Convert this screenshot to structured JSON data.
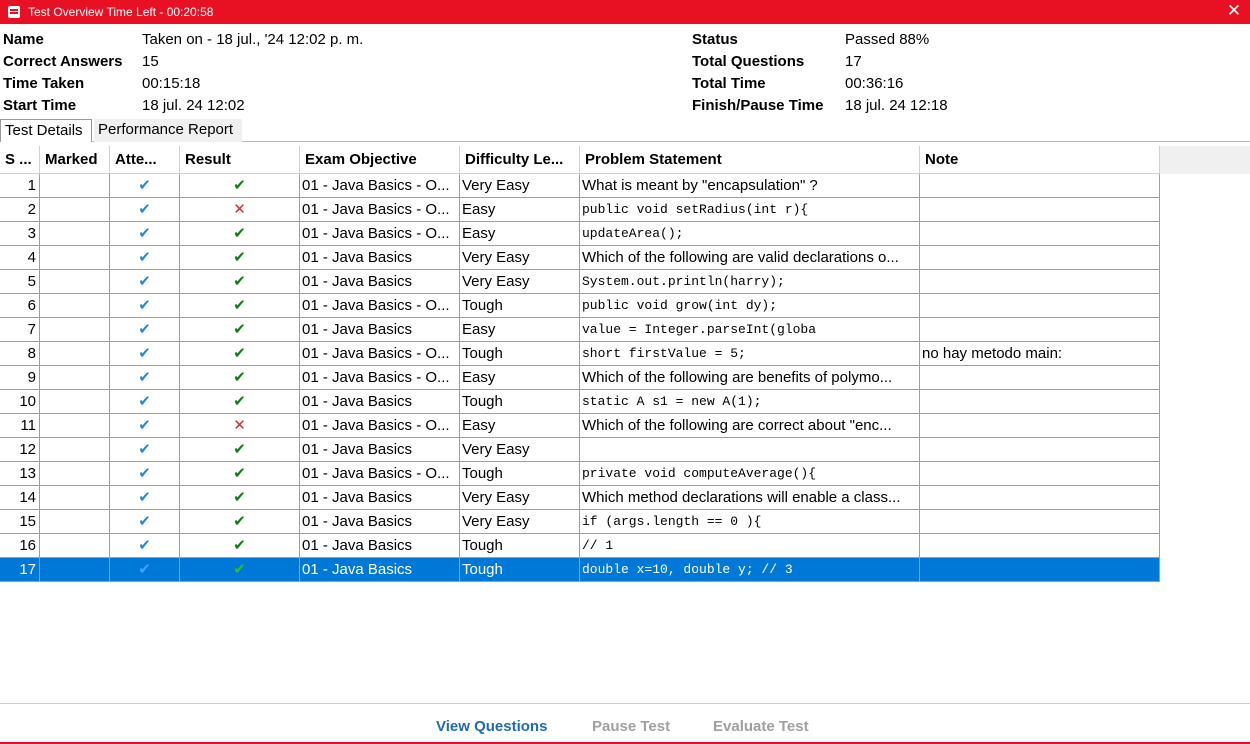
{
  "window": {
    "title": "Test Overview   Time Left - 00:20:58",
    "close_glyph": "✕"
  },
  "summary": {
    "left": [
      {
        "label": "Name",
        "value": "Taken on - 18 jul., '24 12:02 p. m."
      },
      {
        "label": "Correct Answers",
        "value": "15"
      },
      {
        "label": "Time Taken",
        "value": "00:15:18"
      },
      {
        "label": "Start Time",
        "value": "18 jul. 24 12:02"
      }
    ],
    "right": [
      {
        "label": "Status",
        "value": "Passed 88%"
      },
      {
        "label": "Total Questions",
        "value": "17"
      },
      {
        "label": "Total Time",
        "value": "00:36:16"
      },
      {
        "label": "Finish/Pause Time",
        "value": "18 jul. 24 12:18"
      }
    ]
  },
  "tabs": [
    {
      "label": "Test Details",
      "active": true
    },
    {
      "label": "Performance Report",
      "active": false
    }
  ],
  "table": {
    "columns": [
      "S ...",
      "Marked",
      "Atte...",
      "Result",
      "Exam Objective",
      "Difficulty Le...",
      "Problem Statement",
      "Note"
    ],
    "rows": [
      {
        "n": "1",
        "marked": "",
        "attempted": "✔",
        "result": "✔",
        "correct": true,
        "objective": "01 - Java Basics - O...",
        "difficulty": "Very Easy",
        "problem": "What is meant by \"encapsulation\" ?",
        "code": false,
        "note": ""
      },
      {
        "n": "2",
        "marked": "",
        "attempted": "✔",
        "result": "✕",
        "correct": false,
        "objective": "01 - Java Basics - O...",
        "difficulty": "Easy",
        "problem": "    public void setRadius(int r){",
        "code": true,
        "note": ""
      },
      {
        "n": "3",
        "marked": "",
        "attempted": "✔",
        "result": "✔",
        "correct": true,
        "objective": "01 - Java Basics - O...",
        "difficulty": "Easy",
        "problem": "      updateArea();",
        "code": true,
        "note": ""
      },
      {
        "n": "4",
        "marked": "",
        "attempted": "✔",
        "result": "✔",
        "correct": true,
        "objective": "01 - Java Basics",
        "difficulty": "Very Easy",
        "problem": "Which of the following are valid declarations o...",
        "code": false,
        "note": ""
      },
      {
        "n": "5",
        "marked": "",
        "attempted": "✔",
        "result": "✔",
        "correct": true,
        "objective": "01 - Java Basics",
        "difficulty": "Very Easy",
        "problem": "    System.out.println(harry);",
        "code": true,
        "note": ""
      },
      {
        "n": "6",
        "marked": "",
        "attempted": "✔",
        "result": "✔",
        "correct": true,
        "objective": "01 - Java Basics - O...",
        "difficulty": "Tough",
        "problem": "  public void grow(int dy);",
        "code": true,
        "note": ""
      },
      {
        "n": "7",
        "marked": "",
        "attempted": "✔",
        "result": "✔",
        "correct": true,
        "objective": "01 - Java Basics",
        "difficulty": "Easy",
        "problem": "        value = Integer.parseInt(globa",
        "code": true,
        "note": ""
      },
      {
        "n": "8",
        "marked": "",
        "attempted": "✔",
        "result": "✔",
        "correct": true,
        "objective": "01 - Java Basics - O...",
        "difficulty": "Tough",
        "problem": "short firstValue = 5;",
        "code": true,
        "note": "no hay metodo main:"
      },
      {
        "n": "9",
        "marked": "",
        "attempted": "✔",
        "result": "✔",
        "correct": true,
        "objective": "01 - Java Basics - O...",
        "difficulty": "Easy",
        "problem": "Which of the following are benefits of polymo...",
        "code": false,
        "note": ""
      },
      {
        "n": "10",
        "marked": "",
        "attempted": "✔",
        "result": "✔",
        "correct": true,
        "objective": "01 - Java Basics",
        "difficulty": "Tough",
        "problem": "   static A s1 = new A(1);",
        "code": true,
        "note": ""
      },
      {
        "n": "11",
        "marked": "",
        "attempted": "✔",
        "result": "✕",
        "correct": false,
        "objective": "01 - Java Basics - O...",
        "difficulty": "Easy",
        "problem": "Which of the following are correct about \"enc...",
        "code": false,
        "note": ""
      },
      {
        "n": "12",
        "marked": "",
        "attempted": "✔",
        "result": "✔",
        "correct": true,
        "objective": "01 - Java Basics",
        "difficulty": "Very Easy",
        "problem": "",
        "code": false,
        "note": ""
      },
      {
        "n": "13",
        "marked": "",
        "attempted": "✔",
        "result": "✔",
        "correct": true,
        "objective": "01 - Java Basics - O...",
        "difficulty": "Tough",
        "problem": "    private void computeAverage(){",
        "code": true,
        "note": ""
      },
      {
        "n": "14",
        "marked": "",
        "attempted": "✔",
        "result": "✔",
        "correct": true,
        "objective": "01 - Java Basics",
        "difficulty": "Very Easy",
        "problem": "Which method declarations will enable a class...",
        "code": false,
        "note": ""
      },
      {
        "n": "15",
        "marked": "",
        "attempted": "✔",
        "result": "✔",
        "correct": true,
        "objective": "01 - Java Basics",
        "difficulty": "Very Easy",
        "problem": "      if (args.length == 0 ){",
        "code": true,
        "note": ""
      },
      {
        "n": "16",
        "marked": "",
        "attempted": "✔",
        "result": "✔",
        "correct": true,
        "objective": "01 - Java Basics",
        "difficulty": "Tough",
        "problem": "// 1",
        "code": true,
        "note": ""
      },
      {
        "n": "17",
        "marked": "",
        "attempted": "✔",
        "result": "✔",
        "correct": true,
        "objective": "01 - Java Basics",
        "difficulty": "Tough",
        "problem": "       double x=10, double y;  // 3",
        "code": true,
        "note": "",
        "selected": true
      }
    ]
  },
  "actions": {
    "view_questions": "View Questions",
    "pause_test": "Pause Test",
    "evaluate_test": "Evaluate Test"
  }
}
